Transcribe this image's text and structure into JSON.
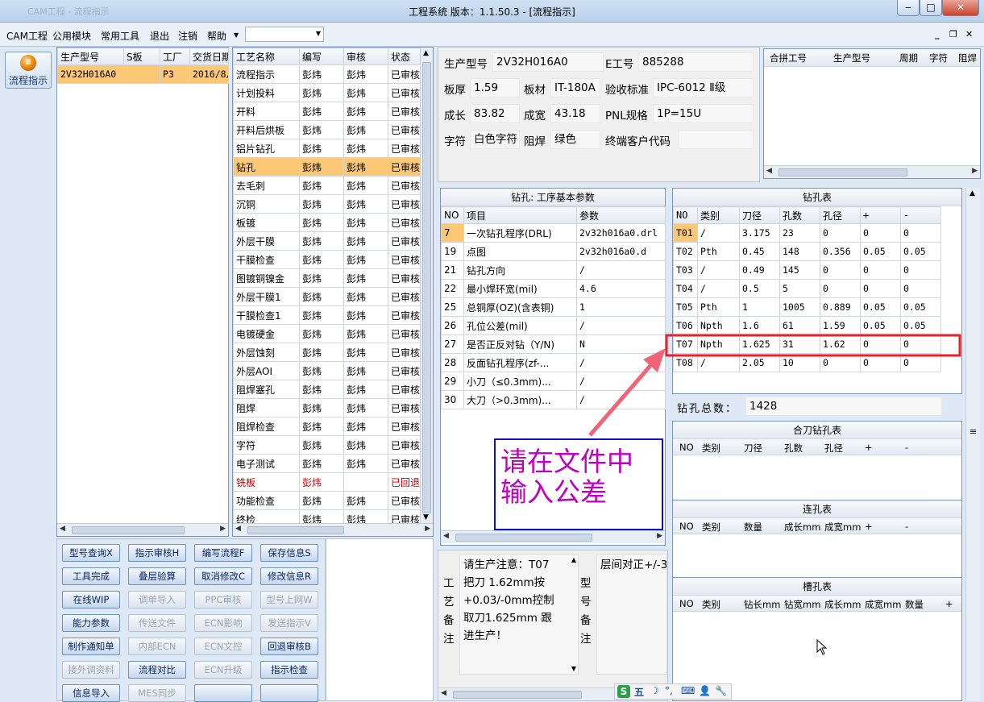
{
  "window": {
    "title": "工程系统  版本：1.1.50.3 - [流程指示]",
    "ghost_title": "CAM工程 - 流程指示",
    "min_label": "‒",
    "max_label": "□",
    "close_label": "✕"
  },
  "menu": {
    "items": [
      "CAM工程",
      "公用模块",
      "常用工具",
      "退出",
      "注销",
      "帮助"
    ],
    "combo_value": "",
    "mdi_min": "_",
    "mdi_restore": "❐",
    "mdi_close": "✕"
  },
  "side": {
    "flow_button_label": "流程指示",
    "flow_icon": "gear-icon"
  },
  "model_list": {
    "headers": [
      "生产型号",
      "S板",
      "工厂",
      "交货日期"
    ],
    "rows": [
      [
        "2V32H016A0",
        "",
        "P3",
        "2016/8/"
      ]
    ]
  },
  "process_list": {
    "headers": [
      "工艺名称",
      "编写",
      "审核",
      "状态"
    ],
    "rows": [
      [
        "流程指示",
        "彭炜",
        "彭炜",
        "已审核"
      ],
      [
        "计划投料",
        "彭炜",
        "彭炜",
        "已审核"
      ],
      [
        "开料",
        "彭炜",
        "彭炜",
        "已审核"
      ],
      [
        "开料后烘板",
        "彭炜",
        "彭炜",
        "已审核"
      ],
      [
        "铝片钻孔",
        "彭炜",
        "彭炜",
        "已审核"
      ],
      [
        "钻孔",
        "彭炜",
        "彭炜",
        "已审核"
      ],
      [
        "去毛刺",
        "彭炜",
        "彭炜",
        "已审核"
      ],
      [
        "沉铜",
        "彭炜",
        "彭炜",
        "已审核"
      ],
      [
        "板镀",
        "彭炜",
        "彭炜",
        "已审核"
      ],
      [
        "外层干膜",
        "彭炜",
        "彭炜",
        "已审核"
      ],
      [
        "干膜检查",
        "彭炜",
        "彭炜",
        "已审核"
      ],
      [
        "图镀铜镍金",
        "彭炜",
        "彭炜",
        "已审核"
      ],
      [
        "外层干膜1",
        "彭炜",
        "彭炜",
        "已审核"
      ],
      [
        "干膜检查1",
        "彭炜",
        "彭炜",
        "已审核"
      ],
      [
        "电镀硬金",
        "彭炜",
        "彭炜",
        "已审核"
      ],
      [
        "外层蚀刻",
        "彭炜",
        "彭炜",
        "已审核"
      ],
      [
        "外层AOI",
        "彭炜",
        "彭炜",
        "已审核"
      ],
      [
        "阻焊塞孔",
        "彭炜",
        "彭炜",
        "已审核"
      ],
      [
        "阻焊",
        "彭炜",
        "彭炜",
        "已审核"
      ],
      [
        "阻焊检查",
        "彭炜",
        "彭炜",
        "已审核"
      ],
      [
        "字符",
        "彭炜",
        "彭炜",
        "已审核"
      ],
      [
        "电子测试",
        "彭炜",
        "彭炜",
        "已审核"
      ],
      [
        "铣板",
        "彭炜",
        "",
        "已回退"
      ],
      [
        "功能检查",
        "彭炜",
        "彭炜",
        "已审核"
      ],
      [
        "终检",
        "彭炜",
        "彭炜",
        "已审核"
      ]
    ]
  },
  "buttons": [
    {
      "label": "型号查询X",
      "enabled": true
    },
    {
      "label": "指示审核H",
      "enabled": true
    },
    {
      "label": "编写流程F",
      "enabled": true
    },
    {
      "label": "保存信息S",
      "enabled": true
    },
    {
      "label": "工具完成",
      "enabled": true
    },
    {
      "label": "叠层验算",
      "enabled": true
    },
    {
      "label": "取消修改C",
      "enabled": true
    },
    {
      "label": "修改信息R",
      "enabled": true
    },
    {
      "label": "在线WIP",
      "enabled": true
    },
    {
      "label": "调单导入",
      "enabled": false
    },
    {
      "label": "PPC审核",
      "enabled": false
    },
    {
      "label": "型号上网W",
      "enabled": false
    },
    {
      "label": "能力参数",
      "enabled": true
    },
    {
      "label": "传送文件",
      "enabled": false
    },
    {
      "label": "ECN影响",
      "enabled": false
    },
    {
      "label": "发送指示V",
      "enabled": false
    },
    {
      "label": "制作通知单",
      "enabled": true
    },
    {
      "label": "内部ECN",
      "enabled": false
    },
    {
      "label": "ECN文控",
      "enabled": false
    },
    {
      "label": "回退审核B",
      "enabled": true
    },
    {
      "label": "接外调资料",
      "enabled": false
    },
    {
      "label": "流程对比",
      "enabled": true
    },
    {
      "label": "ECN升级",
      "enabled": false
    },
    {
      "label": "指示检查",
      "enabled": true
    },
    {
      "label": "信息导入",
      "enabled": true
    },
    {
      "label": "MES同步",
      "enabled": false
    },
    {
      "label": "",
      "enabled": true
    },
    {
      "label": "",
      "enabled": true
    }
  ],
  "info": {
    "model_label": "生产型号",
    "model": "2V32H016A0",
    "eno_label": "E工号",
    "eno": "885288",
    "thickness_label": "板厚",
    "thickness": "1.59",
    "material_label": "板材",
    "material": "IT-180A",
    "standard_label": "验收标准",
    "standard": "IPC-6012 Ⅱ级",
    "length_label": "成长",
    "length": "83.82",
    "width_label": "成宽",
    "width": "43.18",
    "pnl_label": "PNL规格",
    "pnl": "1P=15U",
    "legend_label": "字符",
    "legend": "白色字符",
    "mask_label": "阻焊",
    "mask": "绿色",
    "customer_label": "终端客户代码",
    "customer": ""
  },
  "combine_table": {
    "headers": [
      "合拼工号",
      "生产型号",
      "周期",
      "字符",
      "阻焊"
    ]
  },
  "drill_params": {
    "title": "钻孔: 工序基本参数",
    "headers": [
      "NO",
      "项目",
      "参数"
    ],
    "rows": [
      [
        "7",
        "一次钻孔程序(DRL)",
        "2v32h016a0.drl"
      ],
      [
        "19",
        "点图",
        "2v32h016a0.d"
      ],
      [
        "21",
        "钻孔方向",
        "/"
      ],
      [
        "22",
        "最小焊环宽(mil)",
        "4.6"
      ],
      [
        "25",
        "总铜厚(OZ)(含表铜)",
        "1"
      ],
      [
        "26",
        "孔位公差(mil)",
        "/"
      ],
      [
        "27",
        "是否正反对钻（Y/N)",
        "N"
      ],
      [
        "28",
        "反面钻孔程序(zf-...",
        "/"
      ],
      [
        "29",
        "小刀（≤0.3mm)...",
        "/"
      ],
      [
        "30",
        "大刀（>0.3mm)...",
        "/"
      ]
    ]
  },
  "drill_table": {
    "title": "钻孔表",
    "headers": [
      "NO",
      "类别",
      "刀径",
      "孔数",
      "孔径",
      "+",
      "-"
    ],
    "rows": [
      [
        "T01",
        "/",
        "3.175",
        "23",
        "0",
        "0",
        "0"
      ],
      [
        "T02",
        "Pth",
        "0.45",
        "148",
        "0.356",
        "0.05",
        "0.05"
      ],
      [
        "T03",
        "/",
        "0.49",
        "145",
        "0",
        "0",
        "0"
      ],
      [
        "T04",
        "/",
        "0.5",
        "5",
        "0",
        "0",
        "0"
      ],
      [
        "T05",
        "Pth",
        "1",
        "1005",
        "0.889",
        "0.05",
        "0.05"
      ],
      [
        "T06",
        "Npth",
        "1.6",
        "61",
        "1.59",
        "0.05",
        "0.05"
      ],
      [
        "T07",
        "Npth",
        "1.625",
        "31",
        "1.62",
        "0",
        "0"
      ],
      [
        "T08",
        "/",
        "2.05",
        "10",
        "0",
        "0",
        "0"
      ]
    ],
    "total_label": "钻孔总数：",
    "total": "1428"
  },
  "slot_drill_table": {
    "title": "合刀钻孔表",
    "headers": [
      "NO",
      "类别",
      "刀径",
      "孔数",
      "孔径",
      "+",
      "-"
    ]
  },
  "chain_hole_table": {
    "title": "连孔表",
    "headers": [
      "NO",
      "类别",
      "数量",
      "成长mm",
      "成宽mm",
      "+",
      "-"
    ]
  },
  "slot_table": {
    "title": "槽孔表",
    "headers": [
      "NO",
      "类别",
      "钻长mm",
      "钻宽mm",
      "成长mm",
      "成宽mm",
      "数量",
      "+"
    ]
  },
  "annotation": {
    "text_line1": "请在文件中",
    "text_line2": "输入公差",
    "color": "#c000c0"
  },
  "process_note": {
    "label": "工艺备注",
    "lines": [
      "请生产注意：T07",
      "把刀 1.62mm按",
      "+0.03/-0mm控制",
      "取刀1.625mm 跟",
      "进生产！"
    ]
  },
  "model_note": {
    "label": "型号备注",
    "text": "层间对正+/-3"
  },
  "ime_bar": {
    "items": [
      "S",
      "五",
      "☽",
      "°,",
      "⌨",
      "👤",
      "🔧"
    ]
  }
}
